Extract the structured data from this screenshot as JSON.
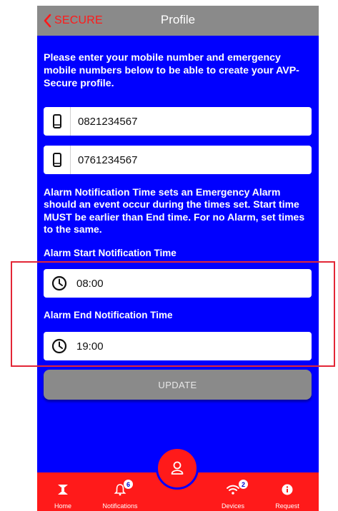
{
  "header": {
    "back_label": "SECURE",
    "title": "Profile"
  },
  "intro_text": "Please enter your mobile number and emergency mobile numbers below to be able to create your AVP-Secure profile.",
  "phone_fields": [
    {
      "value": "0821234567",
      "icon": "mobile-phone-icon"
    },
    {
      "value": "0761234567",
      "icon": "mobile-phone-icon"
    }
  ],
  "alarm_info": "Alarm Notification Time sets an Emergency Alarm should an event occur during the times set. Start time MUST be earlier than End time. For no Alarm, set times to the same.",
  "alarm_start": {
    "label": "Alarm Start Notification Time",
    "value": "08:00",
    "icon": "clock-icon"
  },
  "alarm_end": {
    "label": "Alarm End Notification Time",
    "value": "19:00",
    "icon": "clock-icon"
  },
  "update_label": "UPDATE",
  "tabs": [
    {
      "label": "Home",
      "icon": "home-icon"
    },
    {
      "label": "Notifications",
      "icon": "bell-icon",
      "badge": "6"
    },
    {
      "label": "Devices",
      "icon": "wifi-icon",
      "badge": "2"
    },
    {
      "label": "Request",
      "icon": "info-icon"
    }
  ],
  "center_button_icon": "profile-icon",
  "colors": {
    "background": "#0000ff",
    "header": "#8a8a8a",
    "accent": "#ff1a1a",
    "highlight_box": "#e32636"
  }
}
